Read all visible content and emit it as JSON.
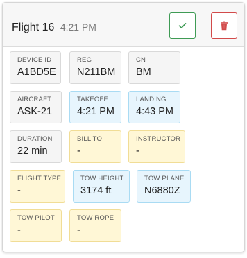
{
  "header": {
    "title": "Flight 16",
    "time": "4:21 PM"
  },
  "actions": {
    "confirm_icon": "check-icon",
    "delete_icon": "trash-icon",
    "confirm_color": "#3f9b55",
    "delete_color": "#d24a4a"
  },
  "fields": {
    "device_id": {
      "label": "DEVICE ID",
      "value": "A1BD5E"
    },
    "reg": {
      "label": "REG",
      "value": "N211BM"
    },
    "cn": {
      "label": "CN",
      "value": "BM"
    },
    "aircraft": {
      "label": "AIRCRAFT",
      "value": "ASK-21"
    },
    "takeoff": {
      "label": "TAKEOFF",
      "value": "4:21 PM"
    },
    "landing": {
      "label": "LANDING",
      "value": "4:43 PM"
    },
    "duration": {
      "label": "DURATION",
      "value": "22 min"
    },
    "bill_to": {
      "label": "BILL TO",
      "value": "-"
    },
    "instructor": {
      "label": "INSTRUCTOR",
      "value": "-"
    },
    "flight_type": {
      "label": "FLIGHT TYPE",
      "value": "-"
    },
    "tow_height": {
      "label": "TOW HEIGHT",
      "value": "3174 ft"
    },
    "tow_plane": {
      "label": "TOW PLANE",
      "value": "N6880Z"
    },
    "tow_pilot": {
      "label": "TOW PILOT",
      "value": "-"
    },
    "tow_rope": {
      "label": "TOW ROPE",
      "value": "-"
    }
  },
  "colors": {
    "tile_gray": "#f5f5f5",
    "tile_blue": "#e7f5fd",
    "tile_yellow": "#fff7d6"
  }
}
